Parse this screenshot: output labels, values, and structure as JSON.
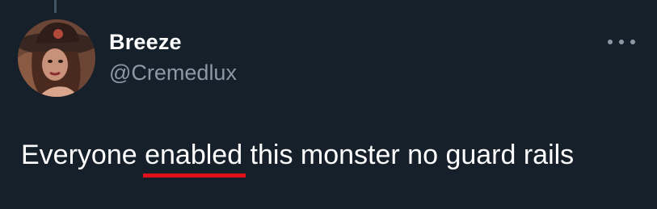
{
  "tweet": {
    "author": {
      "display_name": "Breeze",
      "handle": "@Cremedlux"
    },
    "text": {
      "before": "Everyone ",
      "highlighted": "enabled",
      "after": " this monster no guard rails"
    },
    "more_icon": "more-horizontal-icon",
    "underline_color": "#e0111b"
  }
}
